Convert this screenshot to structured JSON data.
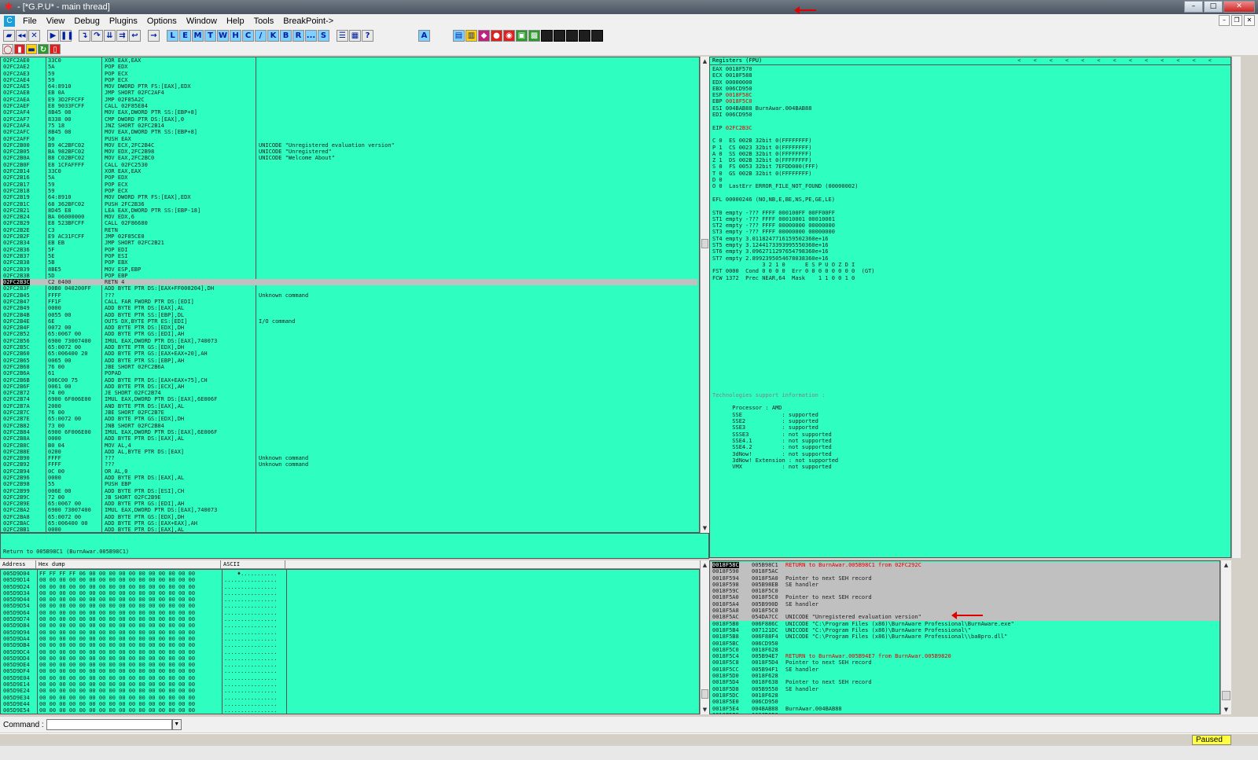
{
  "window": {
    "title": "- [*G.P.U* - main thread]"
  },
  "menu": {
    "items": [
      "File",
      "View",
      "Debug",
      "Plugins",
      "Options",
      "Window",
      "Help",
      "Tools",
      "BreakPoint->"
    ]
  },
  "toolbar": {
    "letters": [
      "L",
      "E",
      "M",
      "T",
      "W",
      "H",
      "C",
      "/",
      "K",
      "B",
      "R",
      "...",
      "S"
    ]
  },
  "cpu": {
    "rows": [
      [
        "02FC2AE0",
        "33C0",
        "XOR EAX,EAX",
        ""
      ],
      [
        "02FC2AE2",
        "5A",
        "POP EDX",
        ""
      ],
      [
        "02FC2AE3",
        "59",
        "POP ECX",
        ""
      ],
      [
        "02FC2AE4",
        "59",
        "POP ECX",
        ""
      ],
      [
        "02FC2AE5",
        "64:8910",
        "MOV DWORD PTR FS:[EAX],EDX",
        ""
      ],
      [
        "02FC2AE8",
        "EB 0A",
        "JMP SHORT 02FC2AF4",
        ""
      ],
      [
        "02FC2AEA",
        "E9 3D2FFCFF",
        "JMP 02F85A2C",
        ""
      ],
      [
        "02FC2AEF",
        "E8 9033FCFF",
        "CALL 02F85E84",
        ""
      ],
      [
        "02FC2AF4",
        "8B45 08",
        "MOV EAX,DWORD PTR SS:[EBP+8]",
        ""
      ],
      [
        "02FC2AF7",
        "8338 00",
        "CMP DWORD PTR DS:[EAX],0",
        ""
      ],
      [
        "02FC2AFA",
        "75 18",
        "JNZ SHORT 02FC2B14",
        ""
      ],
      [
        "02FC2AFC",
        "8B45 08",
        "MOV EAX,DWORD PTR SS:[EBP+8]",
        ""
      ],
      [
        "02FC2AFF",
        "50",
        "PUSH EAX",
        ""
      ],
      [
        "02FC2B00",
        "B9 4C2BFC02",
        "MOV ECX,2FC2B4C",
        "UNICODE \"Unregistered evaluation version\""
      ],
      [
        "02FC2B05",
        "BA 982BFC02",
        "MOV EDX,2FC2B98",
        "UNICODE \"Unregistered\""
      ],
      [
        "02FC2B0A",
        "B8 C02BFC02",
        "MOV EAX,2FC2BC0",
        "UNICODE \"Welcome About\""
      ],
      [
        "02FC2B0F",
        "E8 1CFAFFFF",
        "CALL 02FC2530",
        ""
      ],
      [
        "02FC2B14",
        "33C0",
        "XOR EAX,EAX",
        ""
      ],
      [
        "02FC2B16",
        "5A",
        "POP EDX",
        ""
      ],
      [
        "02FC2B17",
        "59",
        "POP ECX",
        ""
      ],
      [
        "02FC2B18",
        "59",
        "POP ECX",
        ""
      ],
      [
        "02FC2B19",
        "64:8910",
        "MOV DWORD PTR FS:[EAX],EDX",
        ""
      ],
      [
        "02FC2B1C",
        "68 362BFC02",
        "PUSH 2FC2B36",
        ""
      ],
      [
        "02FC2B21",
        "8D45 E8",
        "LEA EAX,DWORD PTR SS:[EBP-18]",
        ""
      ],
      [
        "02FC2B24",
        "BA 06000000",
        "MOV EDX,6",
        ""
      ],
      [
        "02FC2B29",
        "E8 523BFCFF",
        "CALL 02F86680",
        ""
      ],
      [
        "02FC2B2E",
        "C3",
        "RETN",
        ""
      ],
      [
        "02FC2B2F",
        "E9 AC31FCFF",
        "JMP 02F85CE0",
        ""
      ],
      [
        "02FC2B34",
        "EB EB",
        "JMP SHORT 02FC2B21",
        ""
      ],
      [
        "02FC2B36",
        "5F",
        "POP EDI",
        ""
      ],
      [
        "02FC2B37",
        "5E",
        "POP ESI",
        ""
      ],
      [
        "02FC2B38",
        "5B",
        "POP EBX",
        ""
      ],
      [
        "02FC2B39",
        "8BE5",
        "MOV ESP,EBP",
        ""
      ],
      [
        "02FC2B3B",
        "5D",
        "POP EBP",
        ""
      ],
      [
        "02FC2B3C",
        "C2 0400",
        "RETN 4",
        ""
      ],
      [
        "02FC2B3F",
        "00B0 040200FF",
        "ADD BYTE PTR DS:[EAX+FF000204],DH",
        ""
      ],
      [
        "02FC2B45",
        "FFFF",
        "???",
        "Unknown command"
      ],
      [
        "02FC2B47",
        "FF1F",
        "CALL FAR FWORD PTR DS:[EDI]",
        ""
      ],
      [
        "02FC2B49",
        "0000",
        "ADD BYTE PTR DS:[EAX],AL",
        ""
      ],
      [
        "02FC2B4B",
        "0055 00",
        "ADD BYTE PTR SS:[EBP],DL",
        ""
      ],
      [
        "02FC2B4E",
        "6E",
        "OUTS DX,BYTE PTR ES:[EDI]",
        "I/O command"
      ],
      [
        "02FC2B4F",
        "0072 00",
        "ADD BYTE PTR DS:[EDX],DH",
        ""
      ],
      [
        "02FC2B52",
        "65:0067 00",
        "ADD BYTE PTR GS:[EDI],AH",
        ""
      ],
      [
        "02FC2B56",
        "6900 73007400",
        "IMUL EAX,DWORD PTR DS:[EAX],740073",
        ""
      ],
      [
        "02FC2B5C",
        "65:0072 00",
        "ADD BYTE PTR GS:[EDX],DH",
        ""
      ],
      [
        "02FC2B60",
        "65:006400 20",
        "ADD BYTE PTR GS:[EAX+EAX+20],AH",
        ""
      ],
      [
        "02FC2B65",
        "0065 00",
        "ADD BYTE PTR SS:[EBP],AH",
        ""
      ],
      [
        "02FC2B68",
        "76 00",
        "JBE SHORT 02FC2B6A",
        ""
      ],
      [
        "02FC2B6A",
        "61",
        "POPAD",
        ""
      ],
      [
        "02FC2B6B",
        "006C00 75",
        "ADD BYTE PTR DS:[EAX+EAX+75],CH",
        ""
      ],
      [
        "02FC2B6F",
        "0061 00",
        "ADD BYTE PTR DS:[ECX],AH",
        ""
      ],
      [
        "02FC2B72",
        "74 00",
        "JE SHORT 02FC2B74",
        ""
      ],
      [
        "02FC2B74",
        "6900 6F006E00",
        "IMUL EAX,DWORD PTR DS:[EAX],6E006F",
        ""
      ],
      [
        "02FC2B7A",
        "2000",
        "AND BYTE PTR DS:[EAX],AL",
        ""
      ],
      [
        "02FC2B7C",
        "76 00",
        "JBE SHORT 02FC2B7E",
        ""
      ],
      [
        "02FC2B7E",
        "65:0072 00",
        "ADD BYTE PTR GS:[EDX],DH",
        ""
      ],
      [
        "02FC2B82",
        "73 00",
        "JNB SHORT 02FC2B84",
        ""
      ],
      [
        "02FC2B84",
        "6900 6F006E00",
        "IMUL EAX,DWORD PTR DS:[EAX],6E006F",
        ""
      ],
      [
        "02FC2B8A",
        "0000",
        "ADD BYTE PTR DS:[EAX],AL",
        ""
      ],
      [
        "02FC2B8C",
        "B0 04",
        "MOV AL,4",
        ""
      ],
      [
        "02FC2B8E",
        "0200",
        "ADD AL,BYTE PTR DS:[EAX]",
        ""
      ],
      [
        "02FC2B90",
        "FFFF",
        "???",
        "Unknown command"
      ],
      [
        "02FC2B92",
        "FFFF",
        "???",
        "Unknown command"
      ],
      [
        "02FC2B94",
        "0C 00",
        "OR AL,0",
        ""
      ],
      [
        "02FC2B96",
        "0000",
        "ADD BYTE PTR DS:[EAX],AL",
        ""
      ],
      [
        "02FC2B98",
        "55",
        "PUSH EBP",
        ""
      ],
      [
        "02FC2B99",
        "006E 00",
        "ADD BYTE PTR DS:[ESI],CH",
        ""
      ],
      [
        "02FC2B9C",
        "72 00",
        "JB SHORT 02FC2B9E",
        ""
      ],
      [
        "02FC2B9E",
        "65:0067 00",
        "ADD BYTE PTR GS:[EDI],AH",
        ""
      ],
      [
        "02FC2BA2",
        "6900 73007400",
        "IMUL EAX,DWORD PTR DS:[EAX],740073",
        ""
      ],
      [
        "02FC2BA8",
        "65:0072 00",
        "ADD BYTE PTR GS:[EDX],DH",
        ""
      ],
      [
        "02FC2BAC",
        "65:006400 00",
        "ADD BYTE PTR GS:[EAX+EAX],AH",
        ""
      ],
      [
        "02FC2BB1",
        "0000",
        "ADD BYTE PTR DS:[EAX],AL",
        ""
      ],
      [
        "02FC2BB3",
        "00B0 040200FF",
        "ADD BYTE PTR DS:[EAX+FF000204],DH",
        ""
      ]
    ],
    "selected_row": 34
  },
  "info_line": "Return to 005B98C1 (BurnAwar.005B98C1)",
  "registers": {
    "header": "Registers (FPU)",
    "gp": [
      [
        "EAX",
        "0018F570",
        ""
      ],
      [
        "ECX",
        "0018F588",
        ""
      ],
      [
        "EDX",
        "00000000",
        ""
      ],
      [
        "EBX",
        "006CD950",
        ""
      ],
      [
        "ESP",
        "0018F58C",
        ""
      ],
      [
        "EBP",
        "0018F5C0",
        ""
      ],
      [
        "ESI",
        "004BAB88",
        "BurnAwar.004BAB88"
      ],
      [
        "EDI",
        "006CD950",
        ""
      ]
    ],
    "eip": [
      "EIP",
      "02FC2B3C"
    ],
    "flags": [
      "C 0  ES 002B 32bit 0(FFFFFFFF)",
      "P 1  CS 0023 32bit 0(FFFFFFFF)",
      "A 0  SS 002B 32bit 0(FFFFFFFF)",
      "Z 1  DS 002B 32bit 0(FFFFFFFF)",
      "S 0  FS 0053 32bit 7EFDD000(FFF)",
      "T 0  GS 002B 32bit 0(FFFFFFFF)",
      "D 0",
      "O 0  LastErr ERROR_FILE_NOT_FOUND (00000002)"
    ],
    "efl": "EFL 00000246 (NO,NB,E,BE,NS,PE,GE,LE)",
    "fpu": [
      "ST0 empty -??? FFFF 000100FF 00FF00FF",
      "ST1 empty -??? FFFF 00010001 00010001",
      "ST2 empty -??? FFFF 00000000 00000000",
      "ST3 empty -??? FFFF 00000000 00000000",
      "ST4 empty 3.0118247716159502360e+16",
      "ST5 empty 3.1244173393995550360e+16",
      "ST6 empty 3.0962711297654798360e+16",
      "ST7 empty 2.8992395054678038360e+16",
      "               3 2 1 0      E S P U O Z D I",
      "FST 0000  Cond 0 0 0 0  Err 0 0 0 0 0 0 0 0  (GT)",
      "FCW 1372  Prec NEAR,64  Mask    1 1 0 0 1 0"
    ],
    "tech_header": "Technologies support information :",
    "tech": [
      "      Processor : AMD",
      "      SSE            : supported",
      "      SSE2           : supported",
      "      SSE3           : supported",
      "      SSSE3          : not supported",
      "      SSE4.1         : not supported",
      "      SSE4.2         : not supported",
      "      3dNow!         : not supported",
      "      3dNow! Extension : not supported",
      "      VMX            : not supported"
    ],
    "nav_arrows": "<<<<<<<<<<<<<"
  },
  "dump": {
    "headers": [
      "Address",
      "Hex dump",
      "ASCII"
    ],
    "rows": [
      [
        "005D9D04",
        "FF FF FF FF 06 00 00 00 00 00 00 00 00 00 00 00",
        "    ♦..........."
      ],
      [
        "005D9D14",
        "00 00 00 00 00 00 00 00 00 00 00 00 00 00 00 00",
        "................"
      ],
      [
        "005D9D24",
        "00 00 00 00 00 00 00 00 00 00 00 00 00 00 00 00",
        "................"
      ],
      [
        "005D9D34",
        "00 00 00 00 00 00 00 00 00 00 00 00 00 00 00 00",
        "................"
      ],
      [
        "005D9D44",
        "00 00 00 00 00 00 00 00 00 00 00 00 00 00 00 00",
        "................"
      ],
      [
        "005D9D54",
        "00 00 00 00 00 00 00 00 00 00 00 00 00 00 00 00",
        "................"
      ],
      [
        "005D9D64",
        "00 00 00 00 00 00 00 00 00 00 00 00 00 00 00 00",
        "................"
      ],
      [
        "005D9D74",
        "00 00 00 00 00 00 00 00 00 00 00 00 00 00 00 00",
        "................"
      ],
      [
        "005D9D84",
        "00 00 00 00 00 00 00 00 00 00 00 00 00 00 00 00",
        "................"
      ],
      [
        "005D9D94",
        "00 00 00 00 00 00 00 00 00 00 00 00 00 00 00 00",
        "................"
      ],
      [
        "005D9DA4",
        "00 00 00 00 00 00 00 00 00 00 00 00 00 00 00 00",
        "................"
      ],
      [
        "005D9DB4",
        "00 00 00 00 00 00 00 00 00 00 00 00 00 00 00 00",
        "................"
      ],
      [
        "005D9DC4",
        "00 00 00 00 00 00 00 00 00 00 00 00 00 00 00 00",
        "................"
      ],
      [
        "005D9DD4",
        "00 00 00 00 00 00 00 00 00 00 00 00 00 00 00 00",
        "................"
      ],
      [
        "005D9DE4",
        "00 00 00 00 00 00 00 00 00 00 00 00 00 00 00 00",
        "................"
      ],
      [
        "005D9DF4",
        "00 00 00 00 00 00 00 00 00 00 00 00 00 00 00 00",
        "................"
      ],
      [
        "005D9E04",
        "00 00 00 00 00 00 00 00 00 00 00 00 00 00 00 00",
        "................"
      ],
      [
        "005D9E14",
        "00 00 00 00 00 00 00 00 00 00 00 00 00 00 00 00",
        "................"
      ],
      [
        "005D9E24",
        "00 00 00 00 00 00 00 00 00 00 00 00 00 00 00 00",
        "................"
      ],
      [
        "005D9E34",
        "00 00 00 00 00 00 00 00 00 00 00 00 00 00 00 00",
        "................"
      ],
      [
        "005D9E44",
        "00 00 00 00 00 00 00 00 00 00 00 00 00 00 00 00",
        "................"
      ],
      [
        "005D9E54",
        "00 00 00 00 00 00 00 00 00 00 00 00 00 00 00 00",
        "................"
      ]
    ]
  },
  "stack": {
    "rows": [
      [
        "0018F58C",
        "005B98C1",
        "RETURN to BurnAwar.005B98C1 from 02FC292C",
        "red"
      ],
      [
        "0018F590",
        "0018F5AC",
        "",
        ""
      ],
      [
        "0018F594",
        "0018F5A0",
        "Pointer to next SEH record",
        ""
      ],
      [
        "0018F598",
        "005B98EB",
        "SE handler",
        ""
      ],
      [
        "0018F59C",
        "0018F5C0",
        "",
        ""
      ],
      [
        "0018F5A0",
        "0018F5C0",
        "Pointer to next SEH record",
        ""
      ],
      [
        "0018F5A4",
        "005B990D",
        "SE handler",
        ""
      ],
      [
        "0018F5A8",
        "0018F5C0",
        "",
        ""
      ],
      [
        "0018F5AC",
        "054DA7CC",
        "UNICODE \"Unregistered evaluation version\"",
        ""
      ],
      [
        "0018F5B0",
        "006F886C",
        "UNICODE \"C:\\Program Files (x86)\\BurnAware Professional\\BurnAware.exe\"",
        ""
      ],
      [
        "0018F5B4",
        "007121DC",
        "UNICODE \"C:\\Program Files (x86)\\BurnAware Professional\\\"",
        ""
      ],
      [
        "0018F5B8",
        "006F88F4",
        "UNICODE \"C:\\Program Files (x86)\\BurnAware Professional\\\\ba8pro.dll\"",
        ""
      ],
      [
        "0018F5BC",
        "006CD950",
        "",
        ""
      ],
      [
        "0018F5C0",
        "0018F628",
        "",
        ""
      ],
      [
        "0018F5C4",
        "005B94E7",
        "RETURN to BurnAwar.005B94E7 from BurnAwar.005B9820",
        "red"
      ],
      [
        "0018F5C8",
        "0018F5D4",
        "Pointer to next SEH record",
        ""
      ],
      [
        "0018F5CC",
        "005B94F1",
        "SE handler",
        ""
      ],
      [
        "0018F5D0",
        "0018F628",
        "",
        ""
      ],
      [
        "0018F5D4",
        "0018F638",
        "Pointer to next SEH record",
        ""
      ],
      [
        "0018F5D8",
        "005B9550",
        "SE handler",
        ""
      ],
      [
        "0018F5DC",
        "0018F628",
        "",
        ""
      ],
      [
        "0018F5E0",
        "006CD950",
        "",
        ""
      ],
      [
        "0018F5E4",
        "004BAB88",
        "BurnAwar.004BAB88",
        ""
      ],
      [
        "0018F5E8",
        "006CD950",
        "",
        ""
      ]
    ],
    "highlight_upto": 8
  },
  "command": {
    "label": "Command :"
  },
  "status": {
    "state": "Paused"
  }
}
